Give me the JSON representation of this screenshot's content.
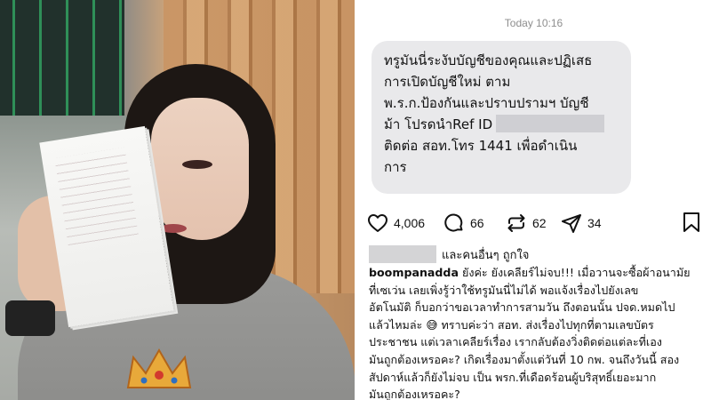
{
  "message": {
    "timestamp": "Today 10:16",
    "lines": [
      "ทรูมันนี่ระงับบัญชีของคุณและปฏิเสธ",
      "การเปิดบัญชีใหม่ ตาม",
      "พ.ร.ก.ป้องกันและปราบปรามฯ บัญชี",
      "ม้า โปรดนำRef ID",
      "ติดต่อ สอท.โทร 1441 เพื่อดำเนิน",
      "การ"
    ]
  },
  "actions": {
    "likes_count": "4,006",
    "comments_count": "66",
    "reposts_count": "62",
    "shares_count": "34",
    "icons": [
      "heart-icon",
      "comment-icon",
      "repost-icon",
      "send-icon",
      "bookmark-icon"
    ]
  },
  "liked_by": {
    "suffix": "และคนอื่นๆ ถูกใจ"
  },
  "caption": {
    "username": "boompanadda",
    "first_line_text": " ยังค่ะ ยังเคลียร์ไม่จบ!!! เมื่อวานจะซื้อผ้าอนามัย",
    "lines": [
      "ที่เซเว่น เลยเพิ่งรู้ว่าใช้ทรูมันนี่ไม่ได้ พอแจ้งเรื่องไปยังเลข",
      "อัตโนมัติ ก็บอกว่าขอเวลาทำการสามวัน ถึงตอนนั้น ปจด.หมดไป",
      "แล้วไหมล่ะ 😅 ทราบค่ะว่า สอท. ส่งเรื่องไปทุกที่ตามเลขบัตร",
      "ประชาชน แต่เวลาเคลียร์เรื่อง เรากลับต้องวิ่งติดต่อแต่ละที่เอง",
      "มันถูกต้องเหรอคะ? เกิดเรื่องมาตั้งแต่วันที่ 10 กพ. จนถึงวันนี้ สอง",
      "สัปดาห์แล้วก็ยังไม่จบ เป็น พรก.ที่เดือดร้อนผู้บริสุทธิ์เยอะมาก",
      "มันถูกต้องเหรอคะ?"
    ]
  }
}
